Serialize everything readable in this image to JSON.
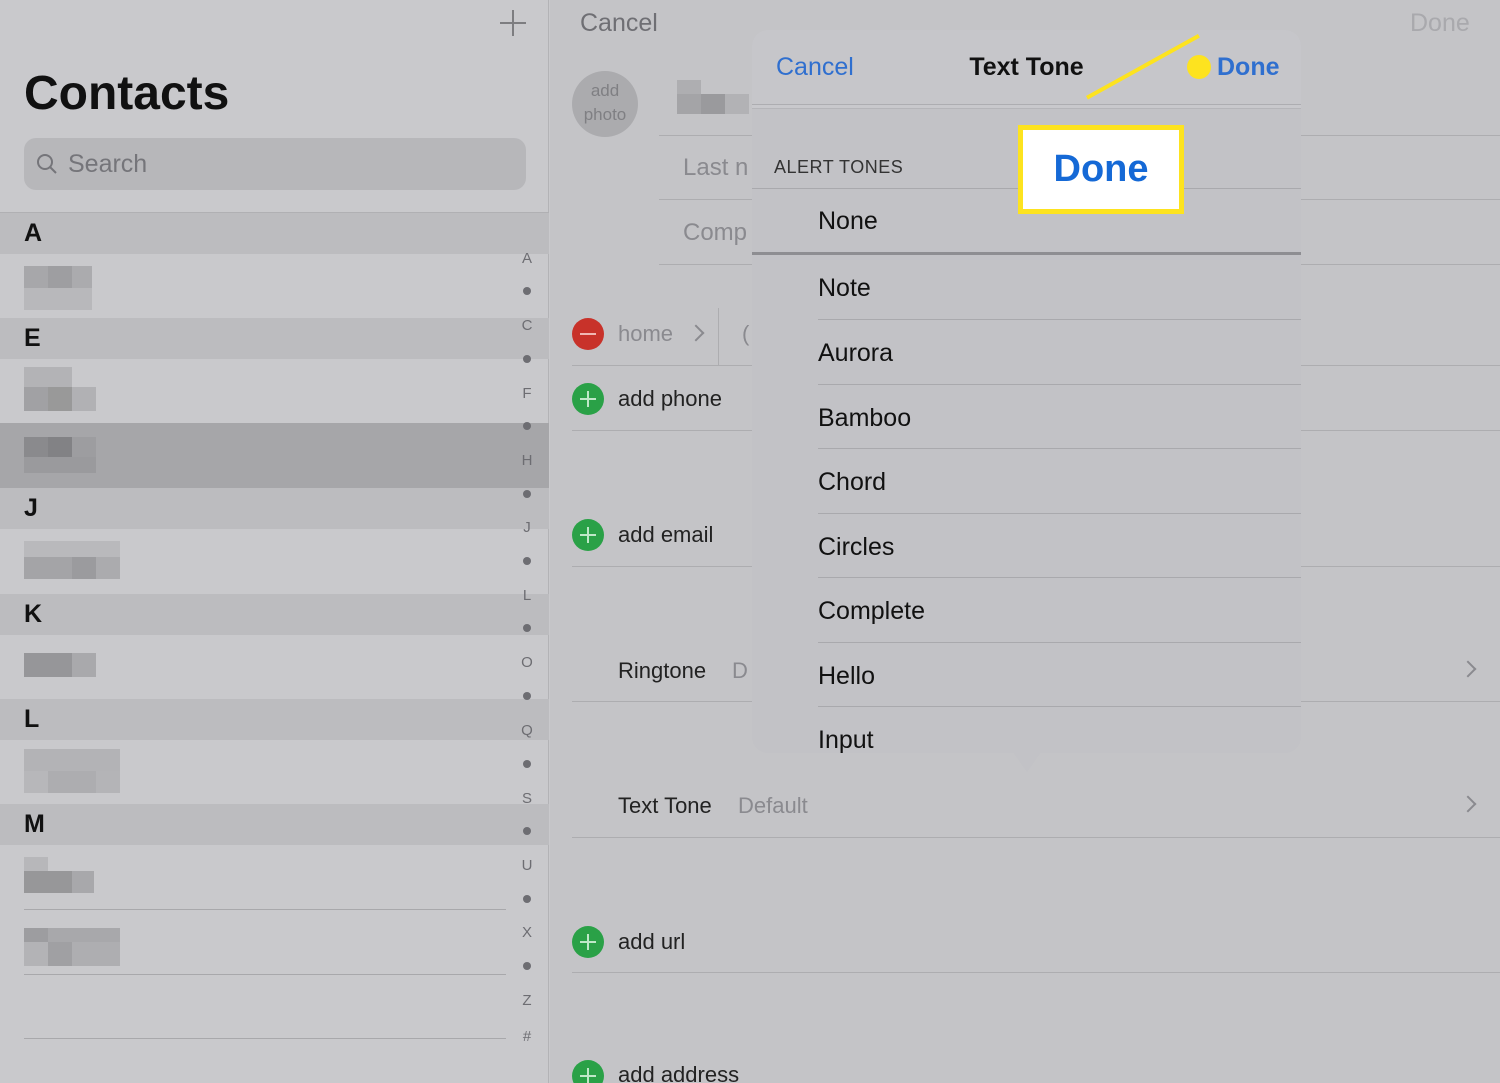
{
  "left": {
    "title": "Contacts",
    "search_placeholder": "Search",
    "sections": [
      "A",
      "E",
      "J",
      "K",
      "L",
      "M"
    ],
    "index": [
      "A",
      "C",
      "F",
      "H",
      "J",
      "L",
      "O",
      "Q",
      "S",
      "U",
      "X",
      "Z",
      "#"
    ]
  },
  "right": {
    "cancel": "Cancel",
    "done": "Done",
    "avatar_line1": "add",
    "avatar_line2": "photo",
    "last_name_placeholder": "Last n",
    "company_placeholder": "Comp",
    "phone_label": "home",
    "phone_value": "(",
    "add_phone": "add phone",
    "add_email": "add email",
    "ringtone_label": "Ringtone",
    "ringtone_value": "D",
    "text_tone_label": "Text Tone",
    "text_tone_value": "Default",
    "add_url": "add url",
    "add_address": "add address"
  },
  "popover": {
    "cancel": "Cancel",
    "title": "Text Tone",
    "done": "Done",
    "section_label": "ALERT TONES",
    "tones": [
      "None",
      "Note",
      "Aurora",
      "Bamboo",
      "Chord",
      "Circles",
      "Complete",
      "Hello",
      "Input"
    ]
  },
  "callout": {
    "label": "Done",
    "color": "#fde31f"
  },
  "colors": {
    "accent_blue": "#2f6fcf",
    "delete_red": "#c8322a",
    "add_green": "#2aa147"
  }
}
